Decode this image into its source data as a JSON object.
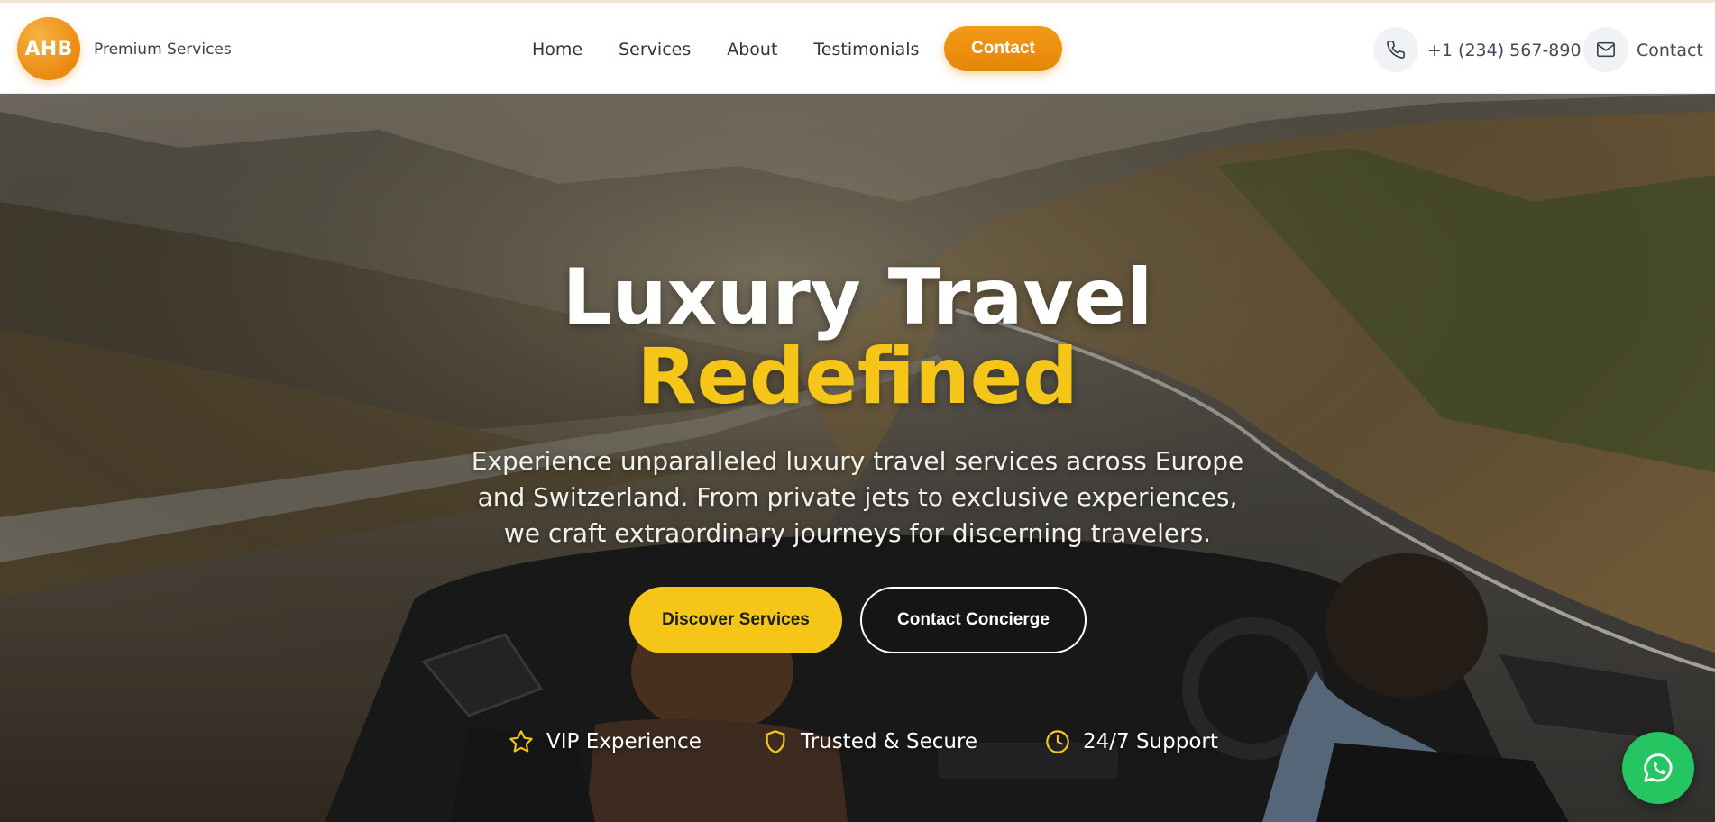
{
  "brand": {
    "logo_text": "AHB",
    "tagline": "Premium Services"
  },
  "nav": {
    "items": [
      {
        "label": "Home"
      },
      {
        "label": "Services"
      },
      {
        "label": "About"
      },
      {
        "label": "Testimonials"
      }
    ],
    "cta_label": "Contact"
  },
  "header_contact": {
    "phone_icon": "phone-icon",
    "phone": "+1 (234) 567-890",
    "mail_icon": "mail-icon",
    "contact_label": "Contact"
  },
  "hero": {
    "title": "Luxury Travel",
    "title_accent": "Redefined",
    "description": "Experience unparalleled luxury travel services across Europe and Switzerland. From private jets to exclusive experiences, we craft extraordinary journeys for discerning travelers.",
    "primary_button": "Discover Services",
    "secondary_button": "Contact Concierge",
    "features": [
      {
        "icon": "star-icon",
        "label": "VIP Experience"
      },
      {
        "icon": "shield-icon",
        "label": "Trusted & Secure"
      },
      {
        "icon": "clock-icon",
        "label": "24/7 Support"
      }
    ]
  },
  "floating": {
    "whatsapp_icon": "whatsapp-icon"
  },
  "colors": {
    "brand_orange": "#ea8a12",
    "accent_yellow": "#f5c518",
    "whatsapp_green": "#25c562",
    "header_bg": "#ffffff",
    "nav_text": "#2d3442"
  }
}
